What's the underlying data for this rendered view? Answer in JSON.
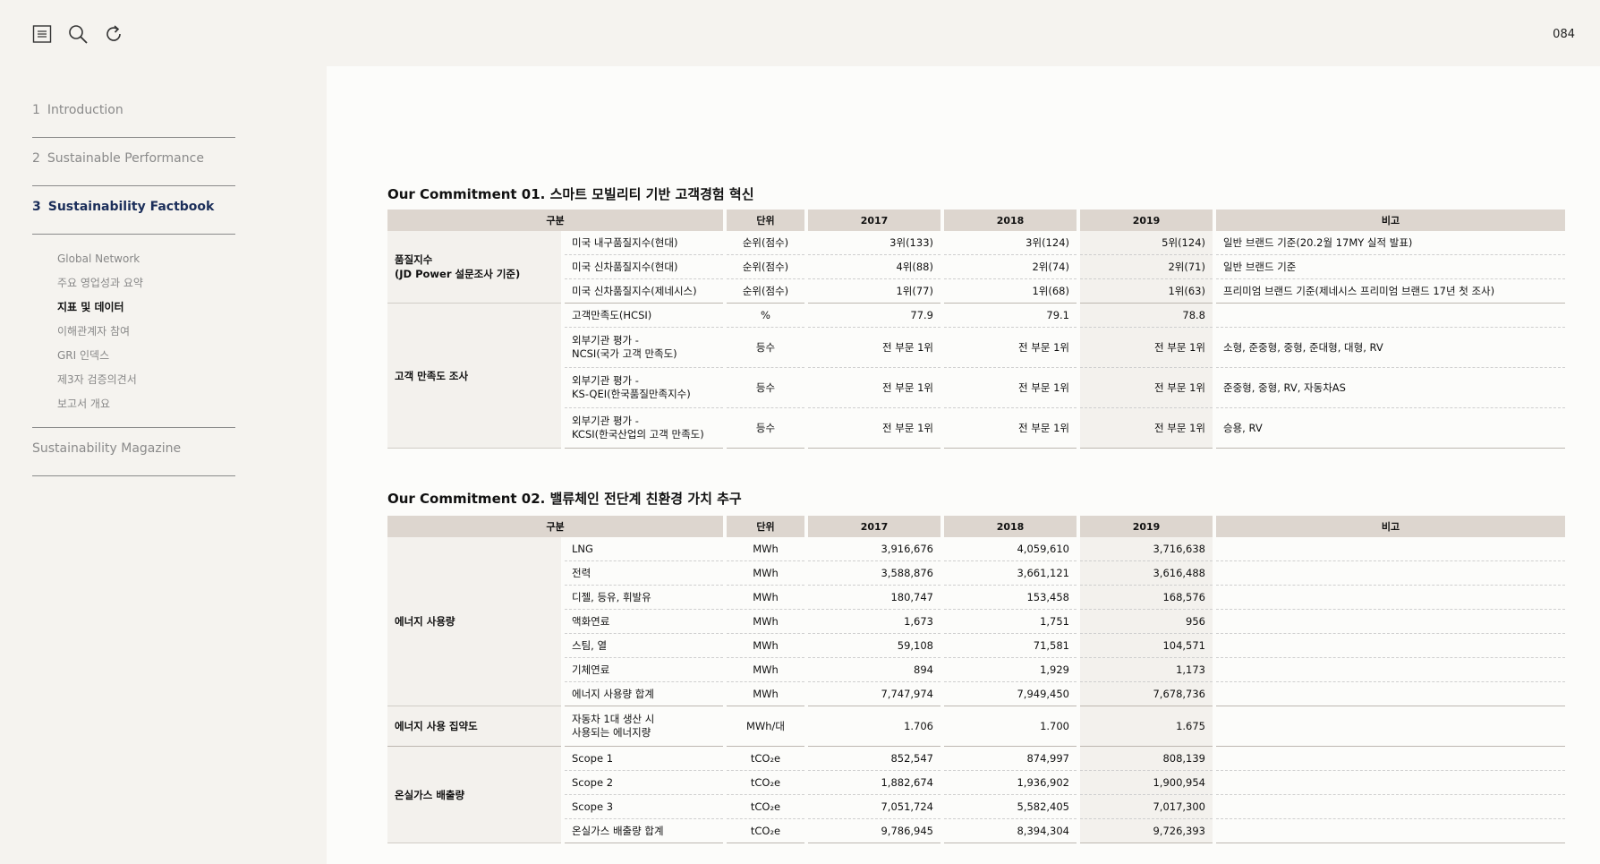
{
  "toolbar": {
    "icons": [
      "menu-icon",
      "search-icon",
      "refresh-icon"
    ]
  },
  "page_number": "084",
  "sidebar": {
    "items": [
      {
        "num": "1",
        "label": "Introduction"
      },
      {
        "num": "2",
        "label": "Sustainable Performance"
      },
      {
        "num": "3",
        "label": "Sustainability Factbook"
      }
    ],
    "sub_items": [
      "Global Network",
      "주요 영업성과 요약",
      "지표 및 데이터",
      "이해관계자 참여",
      "GRI 인덱스",
      "제3자 검증의견서",
      "보고서 개요"
    ],
    "magazine": "Sustainability Magazine"
  },
  "headers": {
    "category": "구분",
    "unit": "단위",
    "y2017": "2017",
    "y2018": "2018",
    "y2019": "2019",
    "note": "비고"
  },
  "section1": {
    "title": "Our Commitment 01. 스마트 모빌리티 기반 고객경험 혁신",
    "groups": [
      {
        "name_line1": "품질지수",
        "name_line2": "(JD Power 설문조사 기준)"
      },
      {
        "name_line1": "고객 만족도 조사",
        "name_line2": ""
      }
    ],
    "rows": [
      {
        "item1": "미국 내구품질지수(현대)",
        "item2": "",
        "unit": "순위(점수)",
        "v2017": "3위(133)",
        "v2018": "3위(124)",
        "v2019": "5위(124)",
        "note": "일반 브랜드 기준(20.2월 17MY 실적 발표)"
      },
      {
        "item1": "미국 신차품질지수(현대)",
        "item2": "",
        "unit": "순위(점수)",
        "v2017": "4위(88)",
        "v2018": "2위(74)",
        "v2019": "2위(71)",
        "note": "일반 브랜드 기준"
      },
      {
        "item1": "미국 신차품질지수(제네시스)",
        "item2": "",
        "unit": "순위(점수)",
        "v2017": "1위(77)",
        "v2018": "1위(68)",
        "v2019": "1위(63)",
        "note": "프리미엄 브랜드 기준(제네시스 프리미엄 브랜드 17년 첫 조사)"
      },
      {
        "item1": "고객만족도(HCSI)",
        "item2": "",
        "unit": "%",
        "v2017": "77.9",
        "v2018": "79.1",
        "v2019": "78.8",
        "note": ""
      },
      {
        "item1": "외부기관 평가 -",
        "item2": "NCSI(국가 고객 만족도)",
        "unit": "등수",
        "v2017": "전 부문 1위",
        "v2018": "전  부문 1위",
        "v2019": "전 부문 1위",
        "note": "소형, 준중형, 중형, 준대형, 대형, RV"
      },
      {
        "item1": "외부기관 평가 -",
        "item2": "KS-QEI(한국품질만족지수)",
        "unit": "등수",
        "v2017": "전 부문 1위",
        "v2018": "전  부문 1위",
        "v2019": "전 부문 1위",
        "note": "준중형, 중형, RV, 자동차AS"
      },
      {
        "item1": "외부기관 평가 -",
        "item2": "KCSI(한국산업의 고객 만족도)",
        "unit": "등수",
        "v2017": "전 부문 1위",
        "v2018": "전  부문 1위",
        "v2019": "전 부문 1위",
        "note": "승용, RV"
      }
    ]
  },
  "section2": {
    "title": "Our Commitment 02. 밸류체인 전단계 친환경 가치 추구",
    "groups": [
      {
        "name": "에너지 사용량"
      },
      {
        "name": "에너지 사용 집약도"
      },
      {
        "name": "온실가스 배출량"
      }
    ],
    "rows": [
      {
        "item1": "LNG",
        "item2": "",
        "unit": "MWh",
        "v2017": "3,916,676",
        "v2018": "4,059,610",
        "v2019": "3,716,638",
        "note": ""
      },
      {
        "item1": "전력",
        "item2": "",
        "unit": "MWh",
        "v2017": "3,588,876",
        "v2018": "3,661,121",
        "v2019": "3,616,488",
        "note": ""
      },
      {
        "item1": "디젤, 등유, 휘발유",
        "item2": "",
        "unit": "MWh",
        "v2017": "180,747",
        "v2018": "153,458",
        "v2019": "168,576",
        "note": ""
      },
      {
        "item1": "액화연료",
        "item2": "",
        "unit": "MWh",
        "v2017": "1,673",
        "v2018": "1,751",
        "v2019": "956",
        "note": ""
      },
      {
        "item1": "스팀, 열",
        "item2": "",
        "unit": "MWh",
        "v2017": "59,108",
        "v2018": "71,581",
        "v2019": "104,571",
        "note": ""
      },
      {
        "item1": "기체연료",
        "item2": "",
        "unit": "MWh",
        "v2017": "894",
        "v2018": "1,929",
        "v2019": "1,173",
        "note": ""
      },
      {
        "item1": "에너지 사용량 합계",
        "item2": "",
        "unit": "MWh",
        "v2017": "7,747,974",
        "v2018": "7,949,450",
        "v2019": "7,678,736",
        "note": ""
      },
      {
        "item1": "자동차 1대 생산 시",
        "item2": "사용되는 에너지량",
        "unit": "MWh/대",
        "v2017": "1.706",
        "v2018": "1.700",
        "v2019": "1.675",
        "note": ""
      },
      {
        "item1": "Scope 1",
        "item2": "",
        "unit": "tCO₂e",
        "v2017": "852,547",
        "v2018": "874,997",
        "v2019": "808,139",
        "note": ""
      },
      {
        "item1": "Scope 2",
        "item2": "",
        "unit": "tCO₂e",
        "v2017": "1,882,674",
        "v2018": "1,936,902",
        "v2019": "1,900,954",
        "note": ""
      },
      {
        "item1": "Scope 3",
        "item2": "",
        "unit": "tCO₂e",
        "v2017": "7,051,724",
        "v2018": "5,582,405",
        "v2019": "7,017,300",
        "note": ""
      },
      {
        "item1": "온실가스 배출량 합계",
        "item2": "",
        "unit": "tCO₂e",
        "v2017": "9,786,945",
        "v2018": "8,394,304",
        "v2019": "9,726,393",
        "note": ""
      }
    ]
  }
}
